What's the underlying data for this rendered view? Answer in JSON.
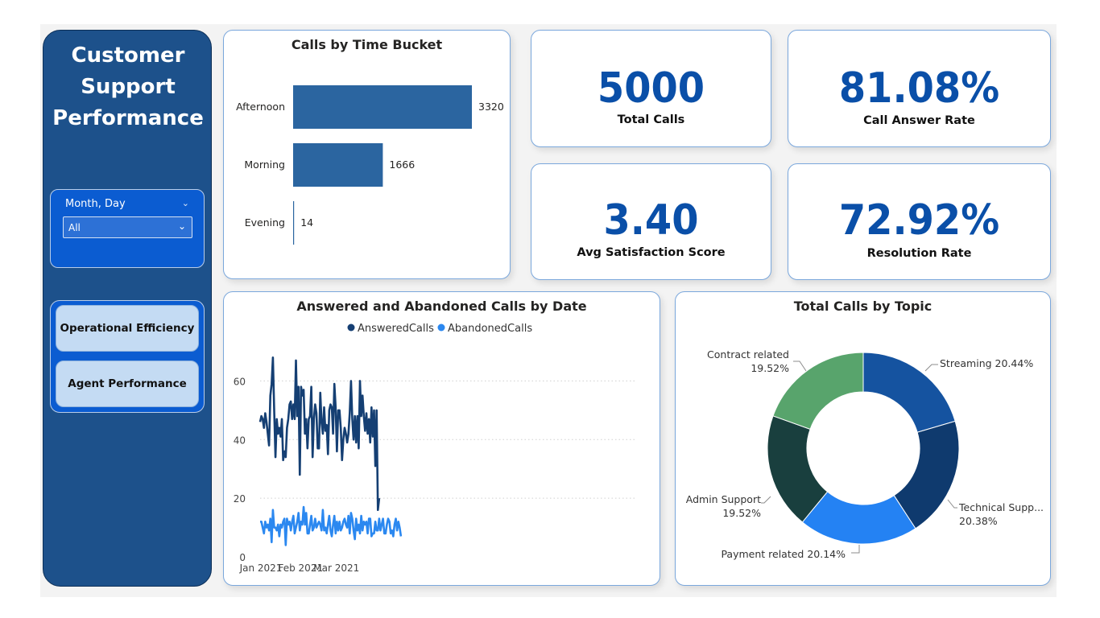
{
  "sidebar": {
    "title_lines": [
      "Customer",
      "Support",
      "Performance"
    ],
    "slicer": {
      "label": "Month, Day",
      "value": "All"
    },
    "nav": [
      {
        "label": "Operational Efficiency"
      },
      {
        "label": "Agent Performance"
      }
    ]
  },
  "kpis": [
    {
      "value": "5000",
      "label": "Total Calls"
    },
    {
      "value": "81.08%",
      "label": "Call Answer Rate"
    },
    {
      "value": "3.40",
      "label": "Avg Satisfaction Score"
    },
    {
      "value": "72.92%",
      "label": "Resolution Rate"
    }
  ],
  "colors": {
    "sidebar": "#1d518b",
    "accent": "#0a4fa8",
    "bar": "#2b65a0",
    "answered": "#153f73",
    "abandoned": "#2b88f0",
    "donut": [
      "#1553a0",
      "#0f3a6e",
      "#2482f3",
      "#193f3e",
      "#58a46c"
    ]
  },
  "chart_data": [
    {
      "type": "bar",
      "orientation": "horizontal",
      "title": "Calls by Time Bucket",
      "categories": [
        "Afternoon",
        "Morning",
        "Evening"
      ],
      "values": [
        3320,
        1666,
        14
      ]
    },
    {
      "type": "line",
      "title": "Answered and Abandoned Calls by Date",
      "x_start": "2021-01-01",
      "x_ticks": [
        "Jan 2021",
        "Feb 2021",
        "Mar 2021"
      ],
      "y_ticks": [
        0,
        20,
        40,
        60
      ],
      "ylim": [
        0,
        70
      ],
      "grid": true,
      "legend_position": "top-center",
      "series": [
        {
          "name": "AnsweredCalls",
          "values": [
            46,
            48,
            47,
            44,
            49,
            46,
            42,
            38,
            55,
            59,
            68,
            50,
            34,
            47,
            42,
            44,
            41,
            47,
            33,
            36,
            34,
            44,
            47,
            52,
            53,
            47,
            52,
            47,
            67,
            48,
            58,
            28,
            58,
            55,
            57,
            42,
            47,
            37,
            47,
            48,
            58,
            34,
            47,
            52,
            49,
            37,
            37,
            56,
            46,
            42,
            51,
            43,
            45,
            35,
            50,
            52,
            51,
            42,
            59,
            51,
            36,
            50,
            50,
            44,
            33,
            40,
            44,
            42,
            39,
            42,
            49,
            60,
            47,
            40,
            48,
            39,
            48,
            37,
            60,
            48,
            55,
            48,
            43,
            49,
            42,
            47,
            39,
            51,
            41,
            50,
            31,
            50,
            16,
            20
          ]
        },
        {
          "name": "AbandonedCalls",
          "values": [
            12,
            12,
            10,
            8,
            12,
            10,
            11,
            9,
            13,
            5,
            16,
            10,
            10,
            9,
            11,
            7,
            11,
            10,
            12,
            13,
            4,
            13,
            11,
            12,
            9,
            12,
            14,
            8,
            10,
            12,
            15,
            9,
            12,
            11,
            17,
            11,
            15,
            8,
            8,
            11,
            14,
            9,
            10,
            13,
            10,
            11,
            12,
            11,
            9,
            16,
            9,
            10,
            8,
            11,
            14,
            9,
            7,
            11,
            14,
            8,
            12,
            9,
            12,
            9,
            10,
            12,
            13,
            11,
            10,
            14,
            8,
            15,
            13,
            9,
            6,
            13,
            9,
            11,
            8,
            14,
            9,
            12,
            11,
            12,
            8,
            13,
            13,
            7,
            8,
            8,
            12,
            9,
            9,
            13,
            9,
            11,
            13,
            8,
            8,
            11,
            13,
            12,
            8,
            9,
            7,
            11,
            13,
            9,
            12,
            10,
            7
          ]
        }
      ]
    },
    {
      "type": "pie",
      "subtype": "donut",
      "title": "Total Calls by Topic",
      "slices": [
        {
          "name": "Streaming",
          "percent": 20.44,
          "label": "Streaming 20.44%"
        },
        {
          "name": "Technical Supp...",
          "percent": 20.38,
          "label": "20.38%"
        },
        {
          "name": "Payment related",
          "percent": 20.14,
          "label": "Payment related 20.14%"
        },
        {
          "name": "Admin Support",
          "percent": 19.52,
          "label": "19.52%"
        },
        {
          "name": "Contract related",
          "percent": 19.52,
          "label": "19.52%"
        }
      ]
    }
  ]
}
